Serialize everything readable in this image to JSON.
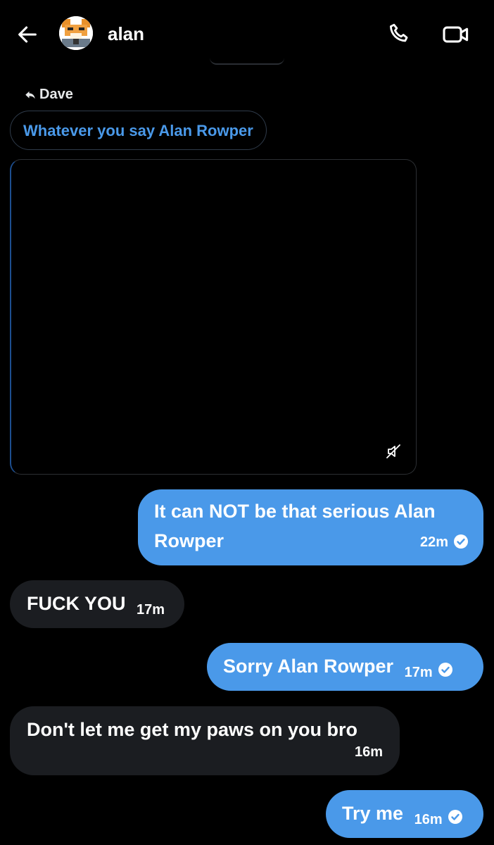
{
  "header": {
    "name": "alan",
    "back_icon": "arrow-left-icon",
    "call_icon": "phone-icon",
    "video_icon": "video-camera-icon"
  },
  "colors": {
    "accent": "#4a99e9",
    "incoming_bubble": "#1b1d21",
    "background": "#000000"
  },
  "reply_context": {
    "label": "Dave",
    "quoted_text": "Whatever you say Alan Rowper"
  },
  "media": {
    "muted_icon": "speaker-muted-icon"
  },
  "messages": [
    {
      "direction": "out",
      "text": "It can NOT be that serious Alan Rowper",
      "time": "22m",
      "read": true
    },
    {
      "direction": "in",
      "text": "FUCK YOU",
      "time": "17m"
    },
    {
      "direction": "out",
      "text": "Sorry Alan Rowper",
      "time": "17m",
      "read": true
    },
    {
      "direction": "in",
      "text": "Don't let me get my paws on you bro",
      "time": "16m"
    },
    {
      "direction": "out",
      "text": "Try me",
      "time": "16m",
      "read": true
    }
  ]
}
